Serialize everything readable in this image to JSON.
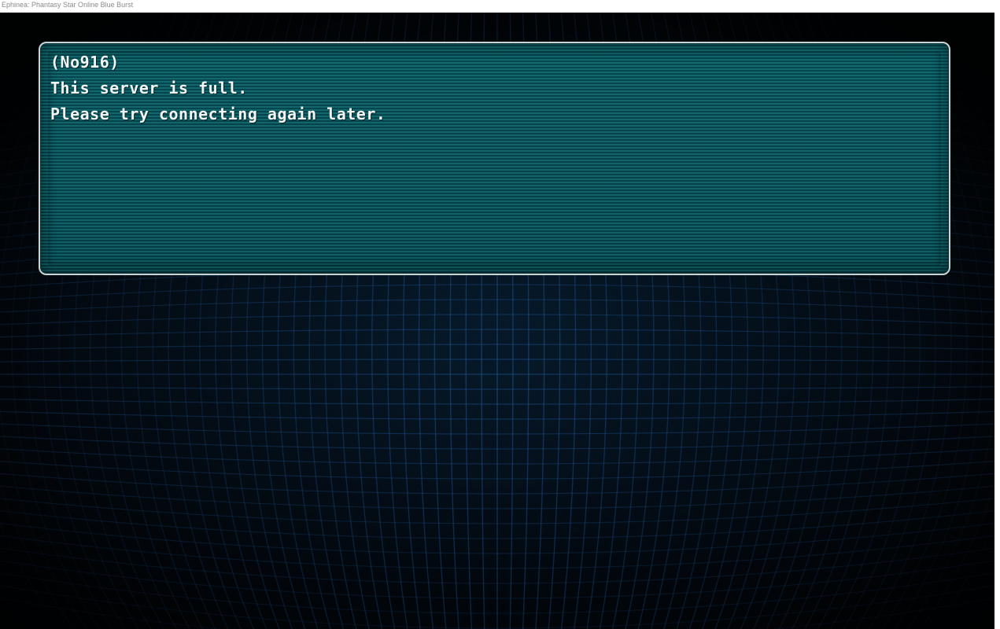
{
  "window": {
    "title": "Ephinea: Phantasy Star Online Blue Burst"
  },
  "dialog": {
    "lines": [
      "(No916)",
      "This server is full.",
      "Please try connecting again later."
    ]
  },
  "colors": {
    "panel": "#0a4b53",
    "panel_border": "#c9d4d4",
    "text": "#f2f6f4",
    "grid": "#1f5a9e",
    "background": "#030a12"
  }
}
